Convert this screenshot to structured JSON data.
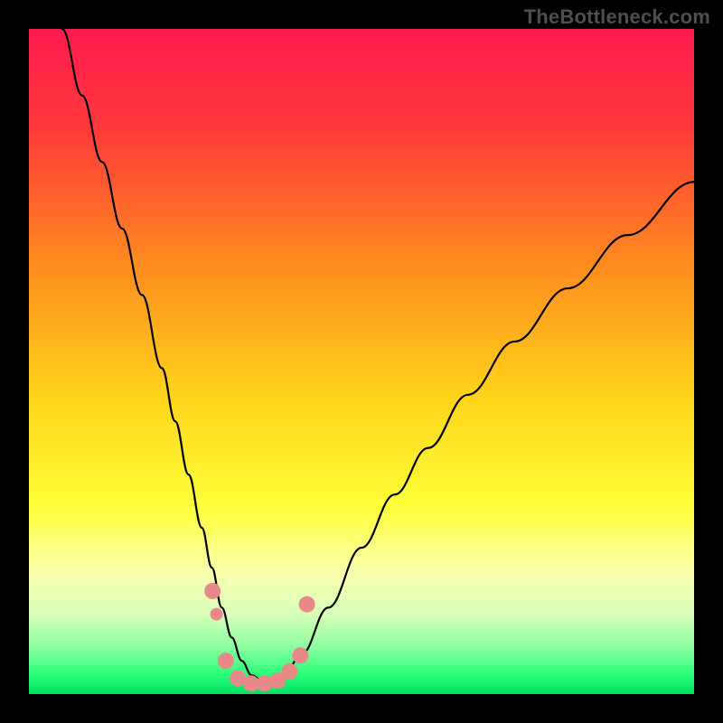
{
  "watermark": "TheBottleneck.com",
  "chart_data": {
    "type": "line",
    "title": "",
    "xlabel": "",
    "ylabel": "",
    "xlim": [
      0,
      100
    ],
    "ylim": [
      0,
      100
    ],
    "grid": false,
    "legend": false,
    "background_gradient_stops": [
      {
        "offset": 0.0,
        "color": "#ff1a4f"
      },
      {
        "offset": 0.15,
        "color": "#ff3a3a"
      },
      {
        "offset": 0.35,
        "color": "#ff8a1f"
      },
      {
        "offset": 0.55,
        "color": "#ffd31a"
      },
      {
        "offset": 0.72,
        "color": "#ffff3a"
      },
      {
        "offset": 0.82,
        "color": "#f8ffb0"
      },
      {
        "offset": 0.88,
        "color": "#d8ffb8"
      },
      {
        "offset": 0.93,
        "color": "#8aff9f"
      },
      {
        "offset": 0.97,
        "color": "#2cff7a"
      },
      {
        "offset": 1.0,
        "color": "#00e060"
      }
    ],
    "series": [
      {
        "name": "bottleneck-curve",
        "stroke": "#000000",
        "stroke_width": 2.2,
        "x": [
          5,
          8,
          11,
          14,
          17,
          20,
          22,
          24,
          26,
          27.5,
          29,
          30.5,
          32,
          33.5,
          35.5,
          38,
          41,
          45,
          50,
          55,
          60,
          66,
          73,
          81,
          90,
          100
        ],
        "y": [
          100,
          90,
          80,
          70,
          60,
          49,
          41,
          33,
          25,
          19,
          13,
          8.5,
          5,
          2.8,
          1.6,
          2.2,
          6,
          13,
          22,
          30,
          37,
          45,
          53,
          61,
          69,
          77
        ]
      }
    ],
    "markers": {
      "name": "highlight-dots",
      "fill": "#e98888",
      "radius_main": 9,
      "radius_small": 7,
      "points": [
        {
          "x": 27.6,
          "y": 15.5,
          "r": "main"
        },
        {
          "x": 28.2,
          "y": 12.0,
          "r": "small"
        },
        {
          "x": 29.6,
          "y": 5.0,
          "r": "main"
        },
        {
          "x": 31.4,
          "y": 2.4,
          "r": "main"
        },
        {
          "x": 33.4,
          "y": 1.6,
          "r": "main"
        },
        {
          "x": 35.4,
          "y": 1.6,
          "r": "main"
        },
        {
          "x": 37.4,
          "y": 2.0,
          "r": "main"
        },
        {
          "x": 39.2,
          "y": 3.4,
          "r": "main"
        },
        {
          "x": 40.8,
          "y": 5.8,
          "r": "main"
        },
        {
          "x": 41.8,
          "y": 13.5,
          "r": "main"
        }
      ]
    }
  }
}
